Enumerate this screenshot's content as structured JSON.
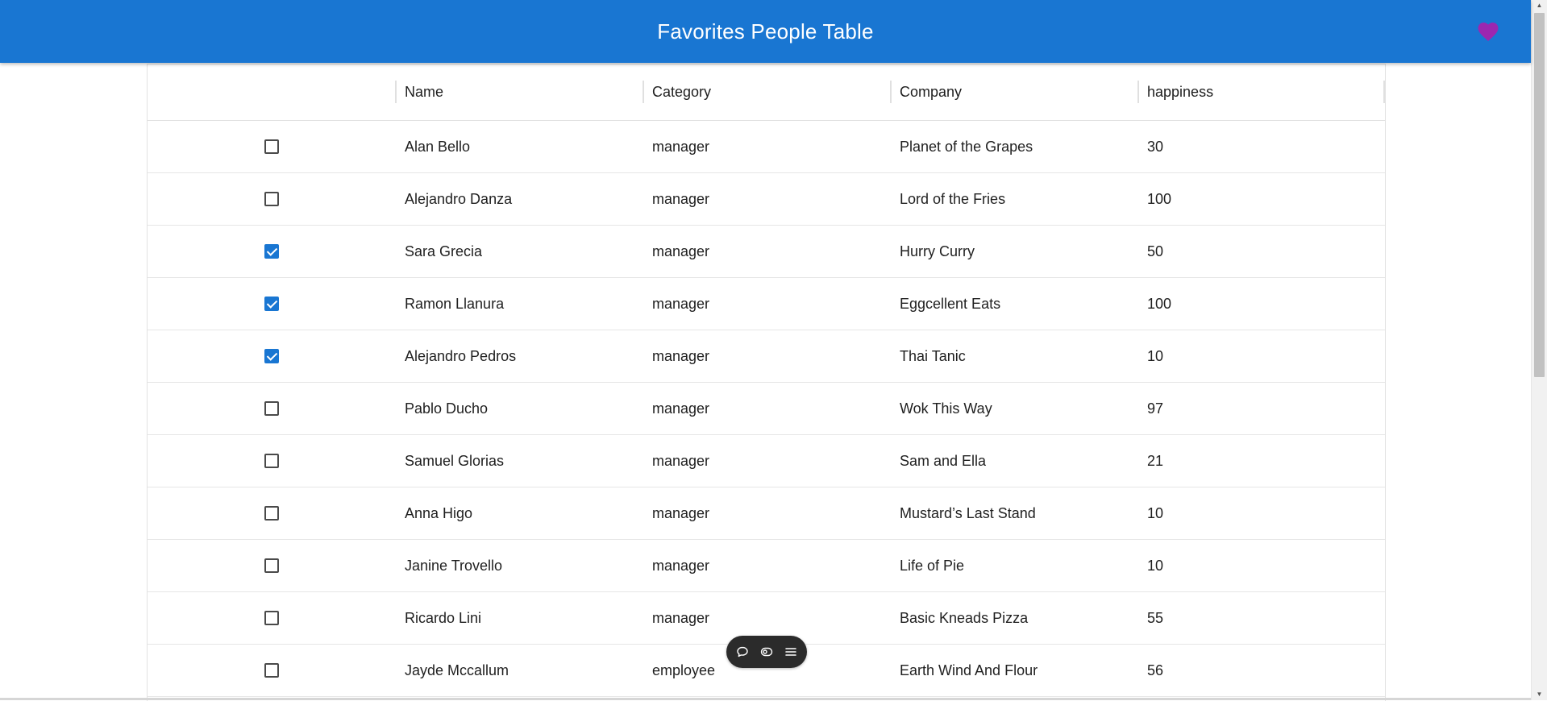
{
  "app": {
    "title": "Favorites People Table",
    "heart_color": "#9c27b0",
    "bar_color": "#1976d2"
  },
  "table": {
    "columns": [
      "Name",
      "Category",
      "Company",
      "happiness"
    ],
    "rows": [
      {
        "checked": false,
        "name": "Alan Bello",
        "category": "manager",
        "company": "Planet of the Grapes",
        "happiness": "30"
      },
      {
        "checked": false,
        "name": "Alejandro Danza",
        "category": "manager",
        "company": "Lord of the Fries",
        "happiness": "100"
      },
      {
        "checked": true,
        "name": "Sara Grecia",
        "category": "manager",
        "company": "Hurry Curry",
        "happiness": "50"
      },
      {
        "checked": true,
        "name": "Ramon Llanura",
        "category": "manager",
        "company": "Eggcellent Eats",
        "happiness": "100"
      },
      {
        "checked": true,
        "name": "Alejandro Pedros",
        "category": "manager",
        "company": "Thai Tanic",
        "happiness": "10"
      },
      {
        "checked": false,
        "name": "Pablo Ducho",
        "category": "manager",
        "company": "Wok This Way",
        "happiness": "97"
      },
      {
        "checked": false,
        "name": "Samuel Glorias",
        "category": "manager",
        "company": "Sam and Ella",
        "happiness": "21"
      },
      {
        "checked": false,
        "name": "Anna Higo",
        "category": "manager",
        "company": "Mustard’s Last Stand",
        "happiness": "10"
      },
      {
        "checked": false,
        "name": "Janine Trovello",
        "category": "manager",
        "company": "Life of Pie",
        "happiness": "10"
      },
      {
        "checked": false,
        "name": "Ricardo Lini",
        "category": "manager",
        "company": "Basic Kneads Pizza",
        "happiness": "55"
      },
      {
        "checked": false,
        "name": "Jayde Mccallum",
        "category": "employee",
        "company": "Earth Wind And Flour",
        "happiness": "56"
      }
    ]
  },
  "toolbar": {
    "icons": [
      "comment-icon",
      "eye-icon",
      "menu-icon"
    ]
  }
}
